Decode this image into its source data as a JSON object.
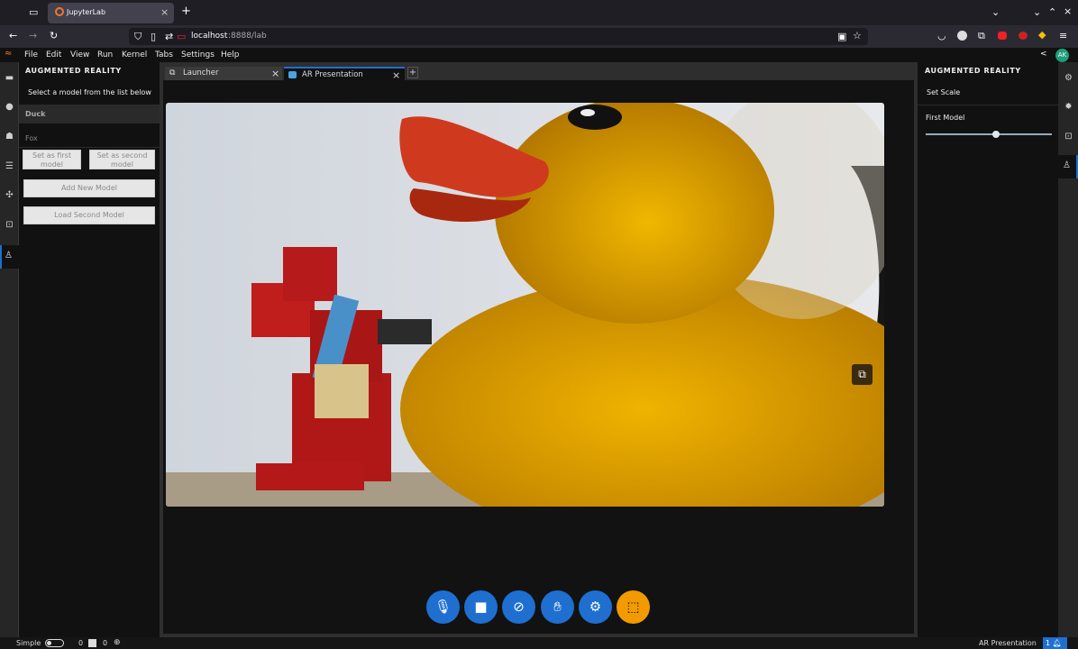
{
  "browser": {
    "tab_title": "JupyterLab",
    "url_host": "localhost",
    "url_rest": ":8888/lab",
    "new_tab": "+"
  },
  "menu": [
    "File",
    "Edit",
    "View",
    "Run",
    "Kernel",
    "Tabs",
    "Settings",
    "Help"
  ],
  "user_initials": "AK",
  "left_panel": {
    "header": "AUGMENTED REALITY",
    "instruction": "Select a model from the list below",
    "models": [
      "Duck",
      "Fox"
    ],
    "set_first": "Set as first model",
    "set_second": "Set as second model",
    "add_model": "Add New Model",
    "load_second": "Load Second Model"
  },
  "doc_tabs": [
    {
      "label": "Launcher",
      "close": "×"
    },
    {
      "label": "AR Presentation",
      "close": "×"
    }
  ],
  "right_panel": {
    "header": "AUGMENTED REALITY",
    "set_scale": "Set Scale",
    "first_model": "First Model",
    "slider_value_fraction": 0.56
  },
  "status": {
    "mode": "Simple",
    "count1": "0",
    "count2": "0",
    "doc": "AR Presentation",
    "notifications": "1"
  },
  "colors": {
    "accent": "#1e6fd0",
    "duck": "#e3a300",
    "orange": "#f29a00"
  }
}
